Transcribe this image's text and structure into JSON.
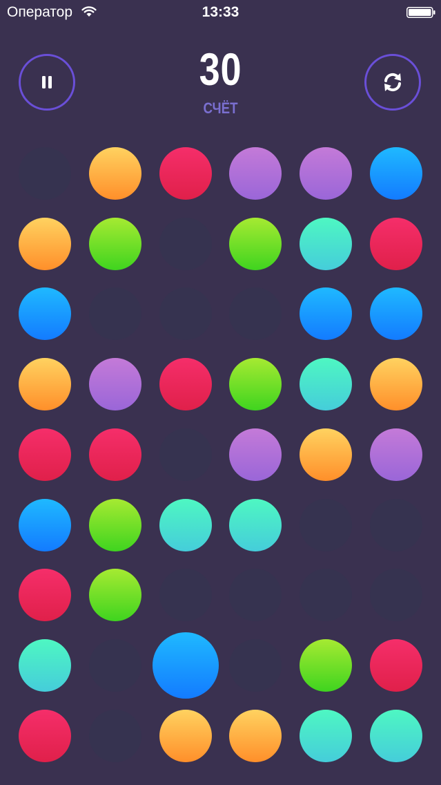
{
  "status": {
    "carrier": "Оператор",
    "time": "13:33"
  },
  "score": {
    "value": "30",
    "label": "СЧЁТ"
  },
  "controls": {
    "pause_icon": "pause-icon",
    "restart_icon": "refresh-icon"
  },
  "colors": {
    "empty": "#363350",
    "orange": [
      "#ffd260",
      "#ff8f2a"
    ],
    "red": [
      "#f52e6a",
      "#e0204a"
    ],
    "purple": [
      "#c47ad8",
      "#9a66d8"
    ],
    "blue": [
      "#1fb9ff",
      "#137bff"
    ],
    "green": [
      "#a6ea32",
      "#3fd41f"
    ],
    "teal": [
      "#4ef7c2",
      "#45cdda"
    ]
  },
  "board": {
    "columns": 6,
    "rows": 9,
    "grid": [
      [
        "empty",
        "orange",
        "red",
        "purple",
        "purple",
        "blue"
      ],
      [
        "orange",
        "green",
        "empty",
        "green",
        "teal",
        "red"
      ],
      [
        "blue",
        "empty",
        "empty",
        "empty",
        "blue",
        "blue"
      ],
      [
        "orange",
        "purple",
        "red",
        "green",
        "teal",
        "orange"
      ],
      [
        "red",
        "red",
        "empty",
        "purple",
        "orange",
        "purple"
      ],
      [
        "blue",
        "green",
        "teal",
        "teal",
        "empty",
        "empty"
      ],
      [
        "red",
        "green",
        "empty",
        "empty",
        "empty",
        "empty"
      ],
      [
        "teal",
        "empty",
        "blue",
        "empty",
        "green",
        "red"
      ],
      [
        "red",
        "empty",
        "orange",
        "orange",
        "teal",
        "teal"
      ]
    ],
    "selected": {
      "row": 7,
      "col": 2
    }
  }
}
